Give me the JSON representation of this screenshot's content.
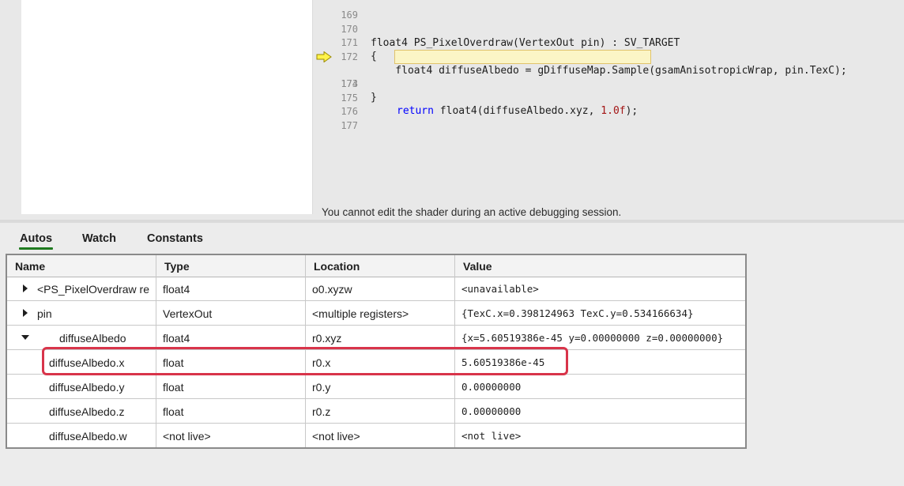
{
  "editor": {
    "lines": [
      {
        "num": "169",
        "text": ""
      },
      {
        "num": "170",
        "text": "float4 PS_PixelOverdraw(VertexOut pin) : SV_TARGET"
      },
      {
        "num": "171",
        "text": "{"
      },
      {
        "num": "172",
        "text": "    float4 diffuseAlbedo = gDiffuseMap.Sample(gsamAnisotropicWrap, pin.TexC);"
      },
      {
        "num": "173",
        "kw": "return",
        "text_mid": " float4(diffuseAlbedo.xyz, ",
        "num_lit": "1.0f",
        "text_end": ");"
      },
      {
        "num": "174",
        "text": "}"
      },
      {
        "num": "175",
        "text": ""
      },
      {
        "num": "176",
        "text": ""
      },
      {
        "num": "177",
        "text": ""
      }
    ],
    "current_line_icon": "arrow-right-icon",
    "readonly_message": "You cannot edit the shader during an active debugging session."
  },
  "tabs": [
    {
      "label": "Autos",
      "active": true
    },
    {
      "label": "Watch",
      "active": false
    },
    {
      "label": "Constants",
      "active": false
    }
  ],
  "table": {
    "columns": [
      "Name",
      "Type",
      "Location",
      "Value"
    ],
    "rows": [
      {
        "name": "<PS_PixelOverdraw re",
        "type": "float4",
        "location": "o0.xyzw",
        "value": "<unavailable>",
        "expander": "collapsed"
      },
      {
        "name": "pin",
        "type": "VertexOut",
        "location": "<multiple registers>",
        "value": "{TexC.x=0.398124963 TexC.y=0.534166634}",
        "expander": "collapsed"
      },
      {
        "name": "diffuseAlbedo",
        "type": "float4",
        "location": "r0.xyz",
        "value": "{x=5.60519386e-45 y=0.00000000 z=0.00000000}",
        "expander": "expanded"
      },
      {
        "name": "diffuseAlbedo.x",
        "type": "float",
        "location": "r0.x",
        "value": "5.60519386e-45",
        "expander": "none"
      },
      {
        "name": "diffuseAlbedo.y",
        "type": "float",
        "location": "r0.y",
        "value": "0.00000000",
        "expander": "none"
      },
      {
        "name": "diffuseAlbedo.z",
        "type": "float",
        "location": "r0.z",
        "value": "0.00000000",
        "expander": "none"
      },
      {
        "name": "diffuseAlbedo.w",
        "type": "<not live>",
        "location": "<not live>",
        "value": "<not live>",
        "expander": "none"
      }
    ]
  },
  "colors": {
    "callout": "#d8344a",
    "active_tab_underline": "#1f7a1f",
    "keyword": "#0000ff",
    "number_literal": "#a31515",
    "current_line_highlight": "#fbf5c6"
  }
}
